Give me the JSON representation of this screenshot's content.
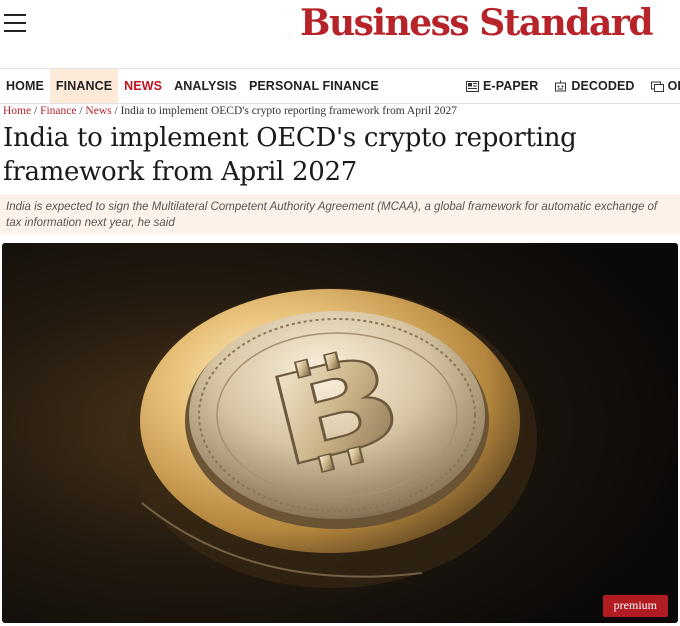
{
  "header": {
    "menu_icon": "hamburger-menu-icon",
    "logo_text": "Business Standard",
    "brand_color": "#b6242a"
  },
  "nav": {
    "items": [
      {
        "label": "HOME"
      },
      {
        "label": "FINANCE",
        "active": true
      },
      {
        "label": "NEWS",
        "highlight_color": "#c1121f"
      },
      {
        "label": "ANALYSIS"
      },
      {
        "label": "PERSONAL FINANCE"
      }
    ],
    "right_items": [
      {
        "label": "E-PAPER",
        "icon": "newspaper-icon"
      },
      {
        "label": "DECODED",
        "icon": "decoded-icon"
      },
      {
        "label": "OPINI",
        "icon": "opinion-icon"
      }
    ]
  },
  "breadcrumb": {
    "items": [
      "Home",
      "Finance",
      "News"
    ],
    "current": "India to implement OECD's crypto reporting framework from April 2027",
    "separator": "/"
  },
  "article": {
    "headline": "India to implement OECD's crypto reporting framework from April 2027",
    "summary": "India is expected to sign the Multilateral Competent Authority Agreement (MCAA), a global framework for automatic exchange of tax information next year, he said",
    "image_alt": "bitcoin-coin-image",
    "badge": "premium",
    "badge_color": "#b01c22"
  }
}
